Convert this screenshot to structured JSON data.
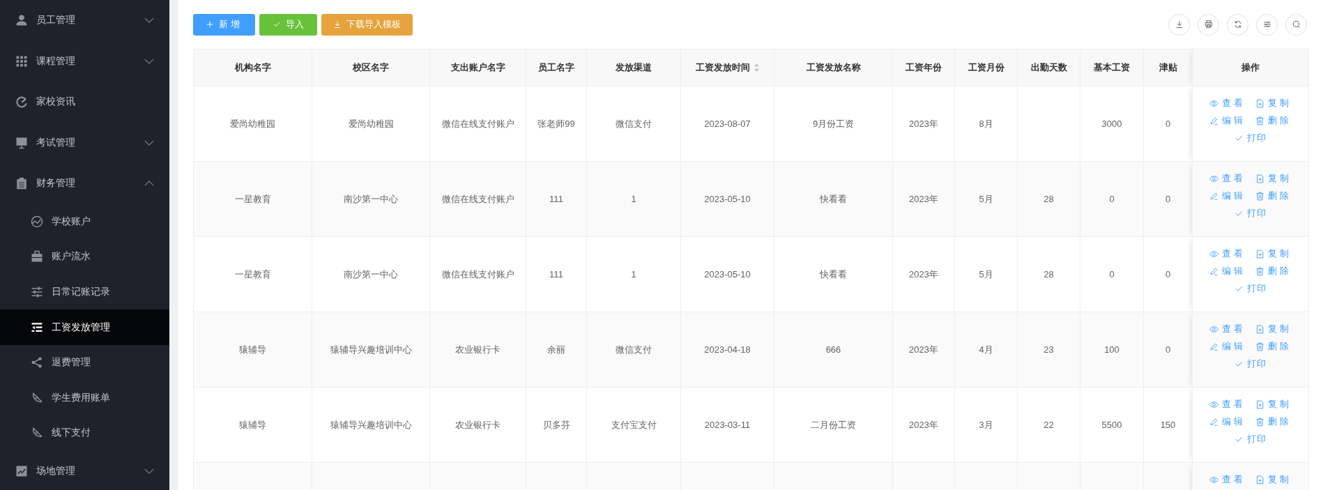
{
  "sidebar": {
    "items": [
      {
        "label": "员工管理",
        "expanded": false,
        "selected": false
      },
      {
        "label": "课程管理",
        "expanded": false,
        "selected": false
      },
      {
        "label": "家校资讯",
        "selected": false
      },
      {
        "label": "考试管理",
        "expanded": false,
        "selected": false
      },
      {
        "label": "财务管理",
        "expanded": true,
        "selected": false,
        "children": [
          {
            "label": "学校账户",
            "selected": false
          },
          {
            "label": "账户流水",
            "selected": false
          },
          {
            "label": "日常记账记录",
            "selected": false
          },
          {
            "label": "工资发放管理",
            "selected": true
          },
          {
            "label": "退费管理",
            "selected": false
          },
          {
            "label": "学生费用账单",
            "selected": false
          },
          {
            "label": "线下支付",
            "selected": false
          }
        ]
      },
      {
        "label": "场地管理",
        "expanded": false,
        "selected": false
      }
    ]
  },
  "toolbar": {
    "buttons": [
      {
        "label": "新 增",
        "kind": "add"
      },
      {
        "label": "导入",
        "kind": "import"
      },
      {
        "label": "下载导入模板",
        "kind": "template"
      }
    ]
  },
  "table": {
    "columns": [
      {
        "label": "机构名字"
      },
      {
        "label": "校区名字"
      },
      {
        "label": "支出账户名字"
      },
      {
        "label": "员工名字"
      },
      {
        "label": "发放渠道"
      },
      {
        "label": "工资发放时间",
        "sortable": true
      },
      {
        "label": "工资发放名称"
      },
      {
        "label": "工资年份"
      },
      {
        "label": "工资月份"
      },
      {
        "label": "出勤天数"
      },
      {
        "label": "基本工资"
      },
      {
        "label": "津贴"
      },
      {
        "label": "操作"
      }
    ],
    "rows": [
      {
        "cells": [
          "爱尚幼稚园",
          "爱尚幼稚园",
          "微信在线支付账户",
          "张老师99",
          "微信支付",
          "2023-08-07",
          "9月份工资",
          "2023年",
          "8月",
          "",
          "3000",
          "0"
        ],
        "actions": [
          {
            "label": "查看",
            "kind": "view"
          },
          {
            "label": "复制",
            "kind": "copy"
          },
          {
            "label": "编辑",
            "kind": "edit"
          },
          {
            "label": "删除",
            "kind": "delete"
          },
          {
            "label": "打印",
            "kind": "print"
          }
        ]
      },
      {
        "cells": [
          "一星教育",
          "南沙第一中心",
          "微信在线支付账户",
          "111",
          "1",
          "2023-05-10",
          "快看看",
          "2023年",
          "5月",
          "28",
          "0",
          "0"
        ],
        "actions": [
          {
            "label": "查看",
            "kind": "view"
          },
          {
            "label": "复制",
            "kind": "copy"
          },
          {
            "label": "编辑",
            "kind": "edit"
          },
          {
            "label": "删除",
            "kind": "delete"
          },
          {
            "label": "打印",
            "kind": "print"
          }
        ]
      },
      {
        "cells": [
          "一星教育",
          "南沙第一中心",
          "微信在线支付账户",
          "111",
          "1",
          "2023-05-10",
          "快看看",
          "2023年",
          "5月",
          "28",
          "0",
          "0"
        ],
        "actions": [
          {
            "label": "查看",
            "kind": "view"
          },
          {
            "label": "复制",
            "kind": "copy"
          },
          {
            "label": "编辑",
            "kind": "edit"
          },
          {
            "label": "删除",
            "kind": "delete"
          },
          {
            "label": "打印",
            "kind": "print"
          }
        ]
      },
      {
        "cells": [
          "猿辅导",
          "猿辅导兴趣培训中心",
          "农业银行卡",
          "余丽",
          "微信支付",
          "2023-04-18",
          "666",
          "2023年",
          "4月",
          "23",
          "100",
          "0"
        ],
        "actions": [
          {
            "label": "查看",
            "kind": "view"
          },
          {
            "label": "复制",
            "kind": "copy"
          },
          {
            "label": "编辑",
            "kind": "edit"
          },
          {
            "label": "删除",
            "kind": "delete"
          },
          {
            "label": "打印",
            "kind": "print"
          }
        ]
      },
      {
        "cells": [
          "猿辅导",
          "猿辅导兴趣培训中心",
          "农业银行卡",
          "贝多芬",
          "支付宝支付",
          "2023-03-11",
          "二月份工资",
          "2023年",
          "3月",
          "22",
          "5500",
          "150"
        ],
        "actions": [
          {
            "label": "查看",
            "kind": "view"
          },
          {
            "label": "复制",
            "kind": "copy"
          },
          {
            "label": "编辑",
            "kind": "edit"
          },
          {
            "label": "删除",
            "kind": "delete"
          },
          {
            "label": "打印",
            "kind": "print"
          }
        ]
      },
      {
        "cells": [
          "",
          "",
          "",
          "",
          "",
          "",
          "",
          "",
          "",
          "",
          "",
          ""
        ],
        "actions": [
          {
            "label": "查看",
            "kind": "view"
          },
          {
            "label": "复制",
            "kind": "copy"
          }
        ]
      }
    ]
  }
}
